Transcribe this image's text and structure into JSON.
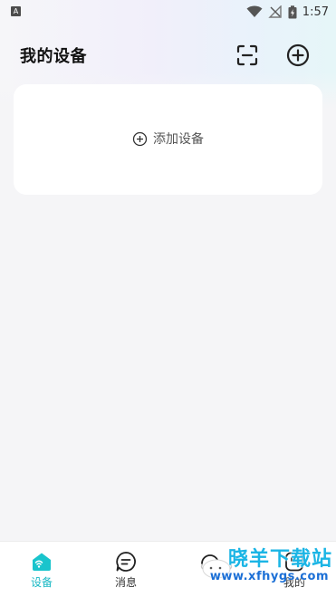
{
  "status_bar": {
    "notification_badge": "A",
    "time": "1:57",
    "icons": [
      "wifi-icon",
      "no-signal-icon",
      "battery-charging-icon"
    ]
  },
  "header": {
    "title": "我的设备",
    "scan_icon": "scan-icon",
    "add_icon": "add-circle-icon"
  },
  "device_card": {
    "add_label": "添加设备",
    "add_icon": "add-circle-icon"
  },
  "tab_bar": {
    "active_color": "#19b8c4",
    "tabs": [
      {
        "label": "设备",
        "icon": "home-device-icon",
        "active": true
      },
      {
        "label": "消息",
        "icon": "message-icon",
        "active": false
      },
      {
        "label": "",
        "icon": "assistant-icon",
        "active": false
      },
      {
        "label": "我的",
        "icon": "profile-icon",
        "active": false
      }
    ]
  },
  "watermark": {
    "text": "晓羊下载站",
    "url": "www.xfhygs.com"
  }
}
